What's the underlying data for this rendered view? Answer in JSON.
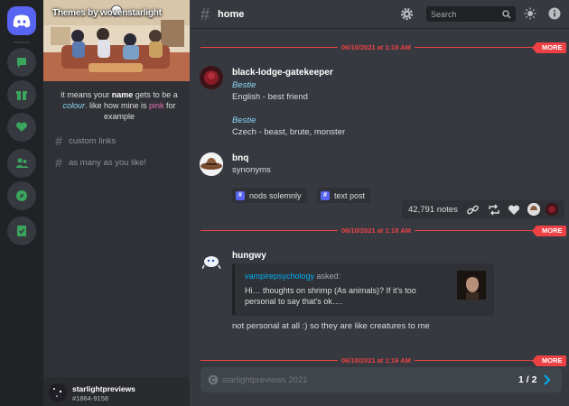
{
  "app": {
    "server_icons": [
      {
        "name": "discord-logo-icon"
      },
      {
        "name": "chat-icon"
      },
      {
        "name": "gift-icon"
      },
      {
        "name": "heart-icon"
      },
      {
        "name": "people-icon"
      },
      {
        "name": "compass-icon"
      },
      {
        "name": "checklist-icon"
      }
    ],
    "accent": "#5865f2",
    "green": "#3ba55d",
    "red": "#ed4245"
  },
  "sidebar": {
    "banner_title": "Themes by wovenstarlight",
    "description": {
      "p1": "it means your ",
      "name": "name",
      "p2": " gets to be a ",
      "colour": "colour",
      "p3": ". like how mine is ",
      "pink": "pink",
      "p4": " for example"
    },
    "channels": [
      {
        "label": "custom links"
      },
      {
        "label": "as many as you like!"
      }
    ],
    "user": {
      "name": "starlightpreviews",
      "tag": "#1864-9158"
    }
  },
  "topbar": {
    "channel_name": "home",
    "search_placeholder": "Search"
  },
  "dividers": [
    {
      "date": "06/10/2021 at 1:18 AM",
      "more": "MORE"
    },
    {
      "date": "06/10/2021 at 1:18 AM",
      "more": "MORE"
    },
    {
      "date": "06/10/2021 at 1:16 AM",
      "more": "MORE"
    }
  ],
  "posts": [
    {
      "author": "black-lodge-gatekeeper",
      "lines": [
        {
          "text": "Bestie",
          "italic": true
        },
        {
          "text": "English - best friend",
          "italic": false
        },
        {
          "text": "Bestie",
          "italic": true
        },
        {
          "text": "Czech - beast, brute, monster",
          "italic": false
        }
      ]
    },
    {
      "author": "bnq",
      "body": "synonyms",
      "tags": [
        "nods solemnly",
        "text post"
      ],
      "notes": "42,791 notes"
    },
    {
      "author": "hungwy",
      "ask": {
        "asker": "vampirepsychology",
        "asked": " asked:",
        "question": "Hi… thoughts on shrimp (As animals)? If it's too personal to say that's ok…."
      },
      "body": "not personal at all :) so they are like creatures to me"
    }
  ],
  "footer": {
    "text": "starlightpreviews 2021",
    "page": "1 / 2"
  }
}
